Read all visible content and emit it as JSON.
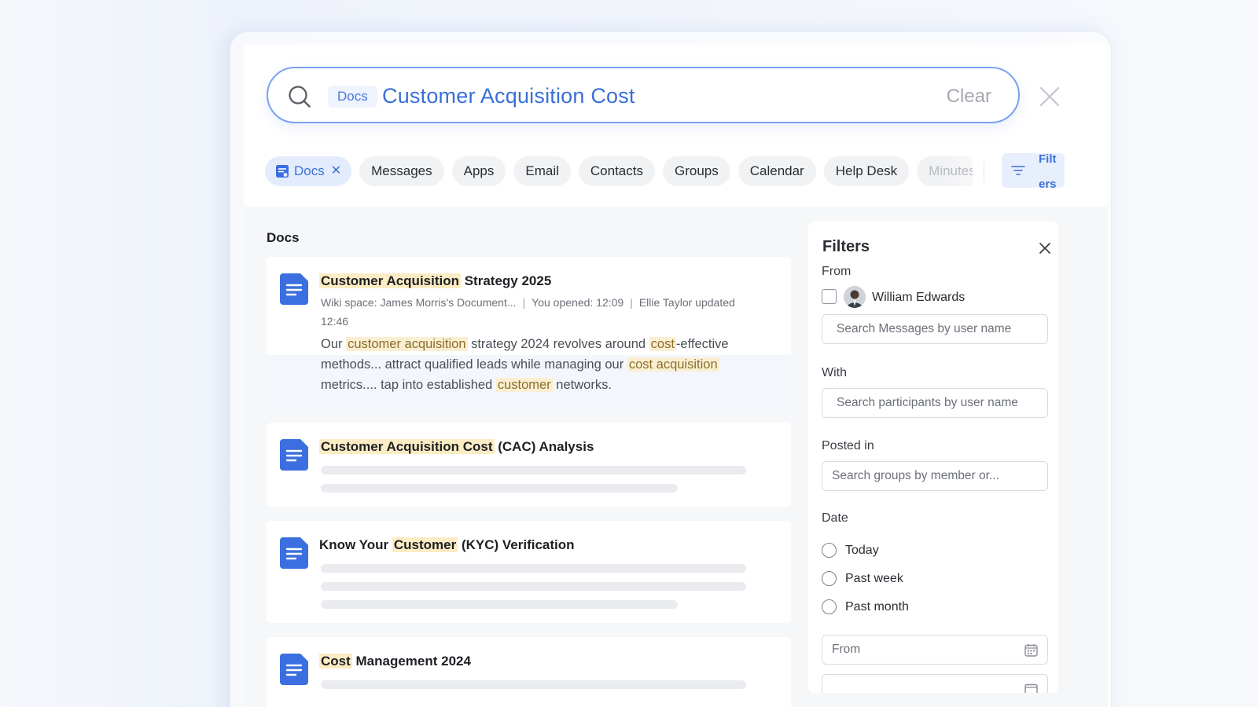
{
  "search": {
    "scope_chip": "Docs",
    "query": "Customer Acquisition Cost",
    "clear_label": "Clear"
  },
  "categories": {
    "active": "Docs",
    "items": [
      "Messages",
      "Apps",
      "Email",
      "Contacts",
      "Groups",
      "Calendar",
      "Help Desk",
      "Minutes"
    ],
    "filters_label": "Filters"
  },
  "results": {
    "section_title": "Docs",
    "cards": [
      {
        "title_hl": "Customer Acquisition",
        "title_rest": " Strategy 2025",
        "meta_space": "Wiki space: James Morris's Document...",
        "meta_opened": "You opened: 12:09",
        "meta_updated": "Ellie Taylor updated",
        "meta_time": "12:46",
        "snippet": {
          "p1": "Our ",
          "h1": "customer acquisition",
          "p2": " strategy 2024 revolves around ",
          "h2": "cost",
          "p3": "-effective methods... attract qualified leads while managing our ",
          "h3": "cost acquisition",
          "p4": " metrics.... tap into established ",
          "h4": "customer",
          "p5": " networks."
        }
      },
      {
        "title_pre": "",
        "title_hl": "Customer Acquisition Cost",
        "title_rest": " (CAC) Analysis"
      },
      {
        "title_pre": "Know Your ",
        "title_hl": "Customer",
        "title_rest": " (KYC) Verification"
      },
      {
        "title_pre": "",
        "title_hl": "Cost",
        "title_rest": " Management 2024"
      }
    ]
  },
  "filters": {
    "title": "Filters",
    "from_label": "From",
    "from_user": "William Edwards",
    "from_placeholder": "Search Messages by user name",
    "with_label": "With",
    "with_placeholder": "Search participants by user name",
    "posted_label": "Posted in",
    "posted_placeholder": "Search groups by member or...",
    "date_label": "Date",
    "date_options": [
      "Today",
      "Past week",
      "Past month"
    ],
    "date_from_placeholder": "From"
  },
  "colors": {
    "accent": "#3a6fd9",
    "highlight": "#fbecc4",
    "doc_icon": "#3b6fe0"
  }
}
